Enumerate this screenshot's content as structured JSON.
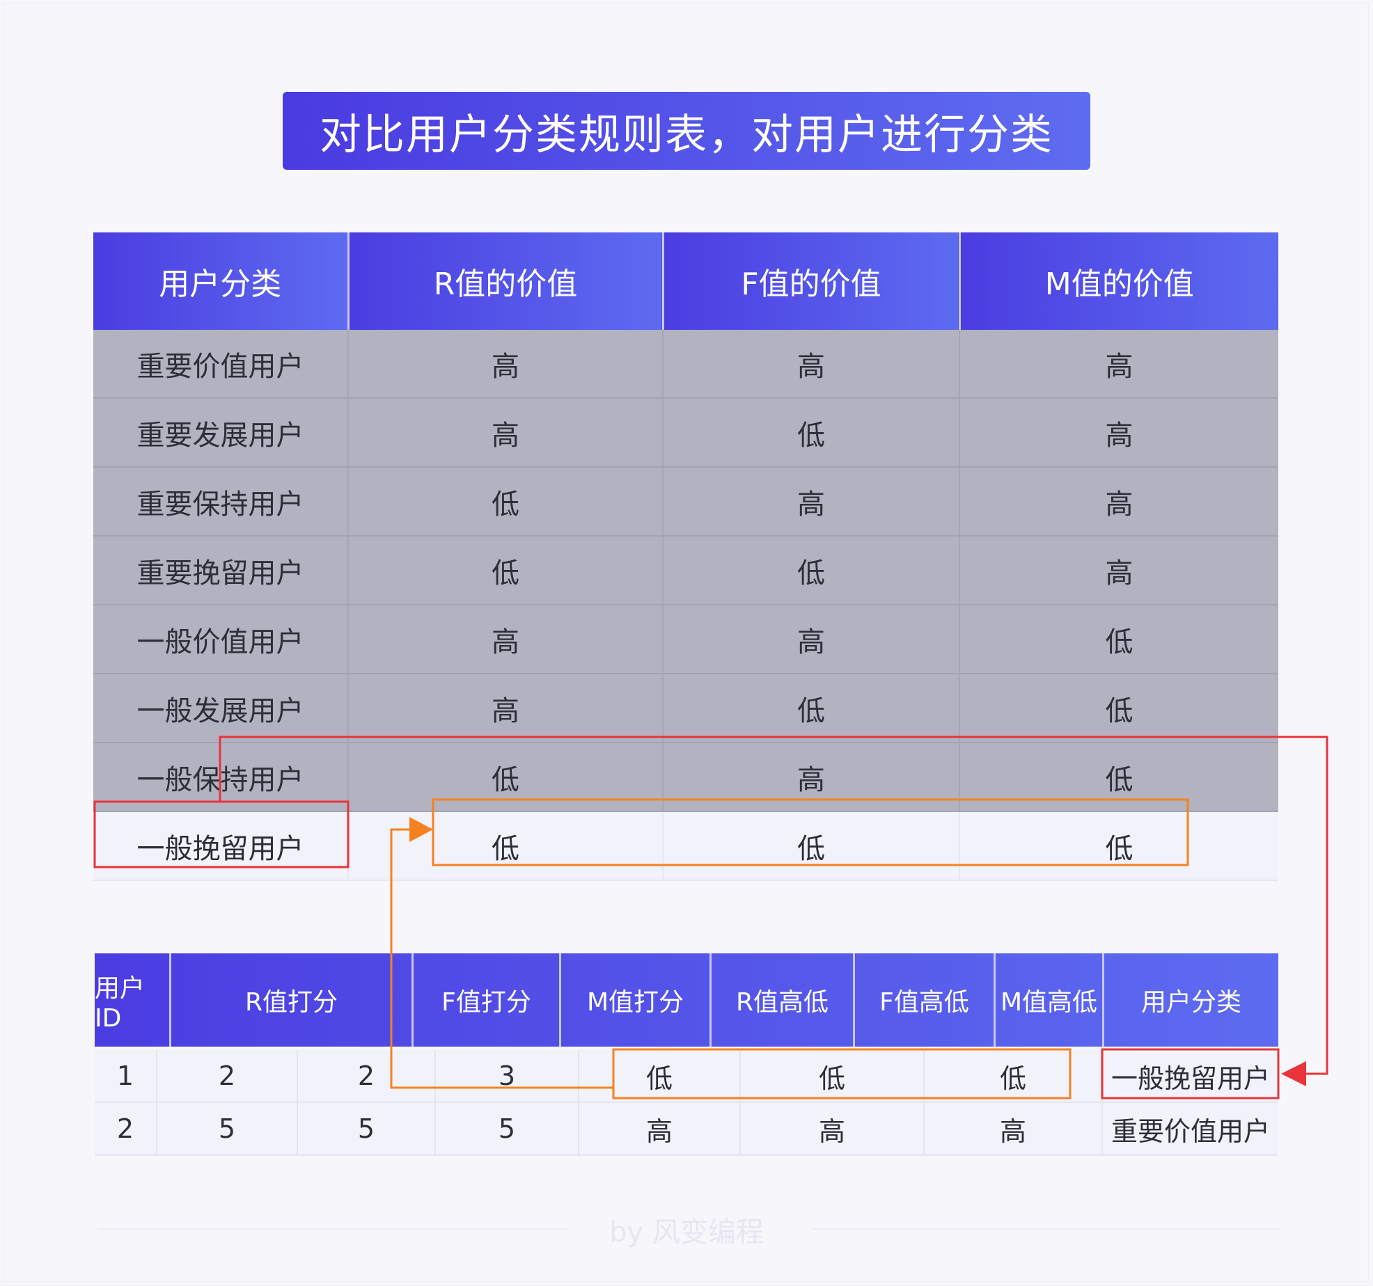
{
  "title": "对比用户分类规则表，对用户进行分类",
  "rules_table": {
    "headers": [
      "用户分类",
      "R值的价值",
      "F值的价值",
      "M值的价值"
    ],
    "rows": [
      [
        "重要价值用户",
        "高",
        "高",
        "高"
      ],
      [
        "重要发展用户",
        "高",
        "低",
        "高"
      ],
      [
        "重要保持用户",
        "低",
        "高",
        "高"
      ],
      [
        "重要挽留用户",
        "低",
        "低",
        "高"
      ],
      [
        "一般价值用户",
        "高",
        "高",
        "低"
      ],
      [
        "一般发展用户",
        "高",
        "低",
        "低"
      ],
      [
        "一般保持用户",
        "低",
        "高",
        "低"
      ],
      [
        "一般挽留用户",
        "低",
        "低",
        "低"
      ]
    ],
    "highlighted_row": 7
  },
  "user_table": {
    "headers": [
      "用户ID",
      "R值打分",
      "F值打分",
      "M值打分",
      "R值高低",
      "F值高低",
      "M值高低",
      "用户分类"
    ],
    "rows": [
      [
        "1",
        "2",
        "2",
        "3",
        "低",
        "低",
        "低",
        "一般挽留用户"
      ],
      [
        "2",
        "5",
        "5",
        "5",
        "高",
        "高",
        "高",
        "重要价值用户"
      ]
    ]
  },
  "watermark": "by 风变编程",
  "colors": {
    "header_gradient_start": "#4b3de1",
    "header_gradient_end": "#5d6bf0",
    "dimmed_row": "#b3b2c0",
    "highlight_row": "#f2f2fa",
    "red_marker": "#e8343a",
    "orange_marker": "#f5821f"
  }
}
